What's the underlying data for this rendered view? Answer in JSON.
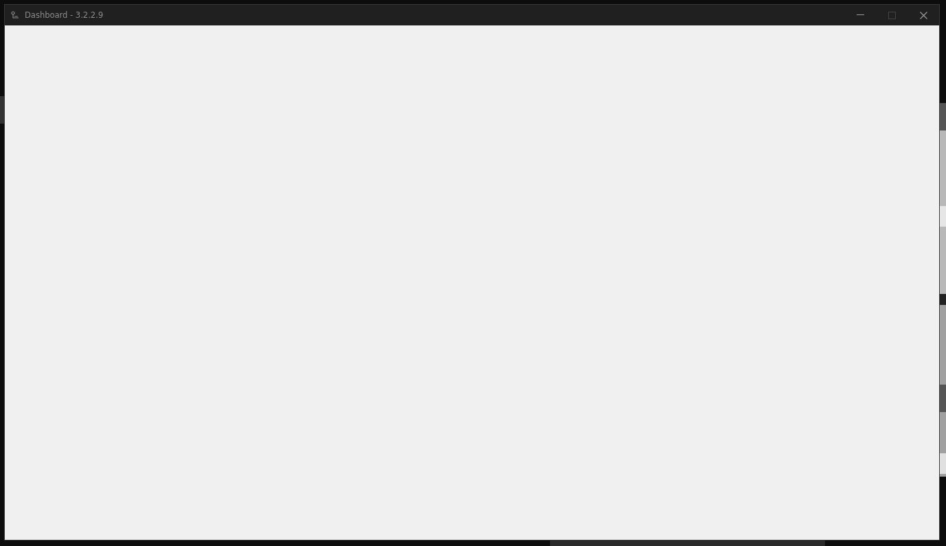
{
  "window": {
    "title": "Dashboard - 3.2.2.9",
    "controls": [
      {
        "kind": "minimize",
        "disabled": false
      },
      {
        "kind": "maximize",
        "disabled": true
      },
      {
        "kind": "close",
        "disabled": false
      }
    ]
  }
}
